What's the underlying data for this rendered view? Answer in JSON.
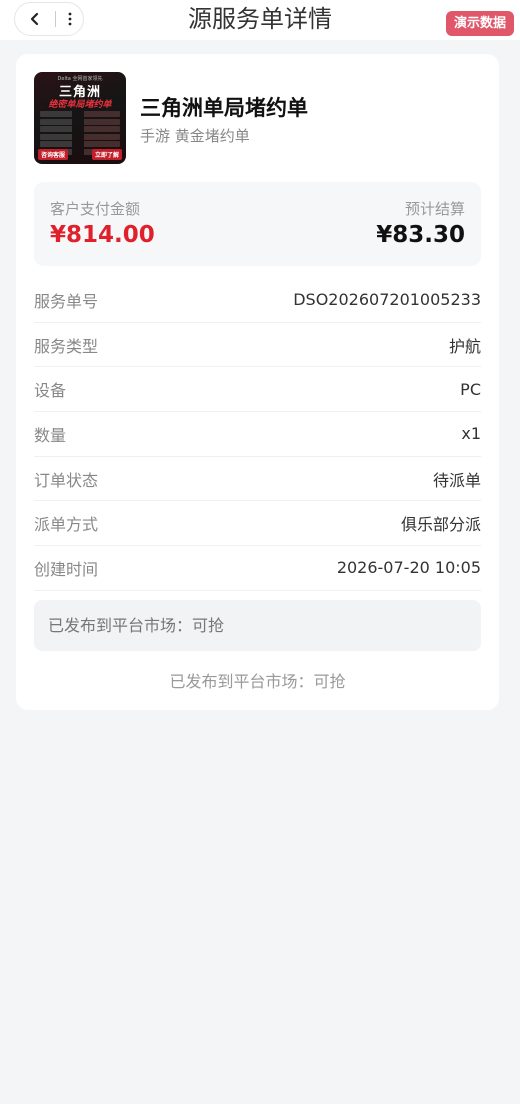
{
  "header": {
    "title": "源服务单详情",
    "demo_badge": "演示数据"
  },
  "product": {
    "title": "三角洲单局堵约单",
    "subtitle": "手游 黄金堵约单",
    "thumb": {
      "top_text": "Delta 全网首家领先",
      "main": "三角洲",
      "sub": "绝密单局堵约单",
      "btn_left": "咨询客服",
      "btn_right": "立即了解"
    }
  },
  "amounts": {
    "customer_label": "客户支付金额",
    "customer_value": "¥814.00",
    "settle_label": "预计结算",
    "settle_value": "¥83.30"
  },
  "details": [
    {
      "label": "服务单号",
      "value": "DSO202607201005233"
    },
    {
      "label": "服务类型",
      "value": "护航"
    },
    {
      "label": "设备",
      "value": "PC"
    },
    {
      "label": "数量",
      "value": "x1"
    },
    {
      "label": "订单状态",
      "value": "待派单"
    },
    {
      "label": "派单方式",
      "value": "俱乐部分派"
    },
    {
      "label": "创建时间",
      "value": "2026-07-20 10:05"
    }
  ],
  "notice_box": "已发布到平台市场：可抢",
  "notice_plain": "已发布到平台市场：可抢",
  "colors": {
    "accent_red": "#e0202a",
    "badge": "#e0576a"
  },
  "icons": {
    "back": "chevron-left-icon",
    "more": "more-vertical-icon"
  }
}
